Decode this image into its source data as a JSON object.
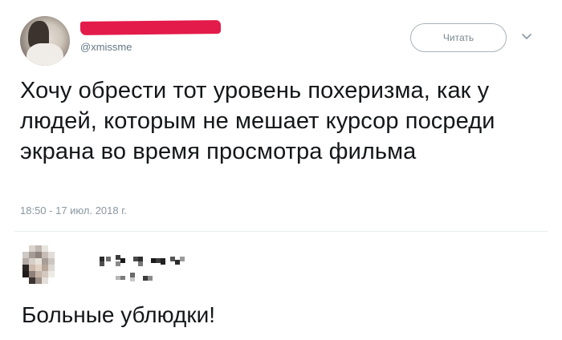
{
  "tweet": {
    "handle": "@xmissme",
    "follow_label": "Читать",
    "text": "Хочу обрести тот уровень похеризма, как у людей, которым не мешает курсор посреди экрана во время просмотра фильма",
    "timestamp": "18:50 - 17 июл. 2018 г.",
    "menu_icon": "chevron-down-icon"
  },
  "reply": {
    "text": "Больные ублюдки!"
  },
  "colors": {
    "redaction": "#e31b4a",
    "secondary_text": "#657786",
    "divider": "#e6ecf0"
  }
}
